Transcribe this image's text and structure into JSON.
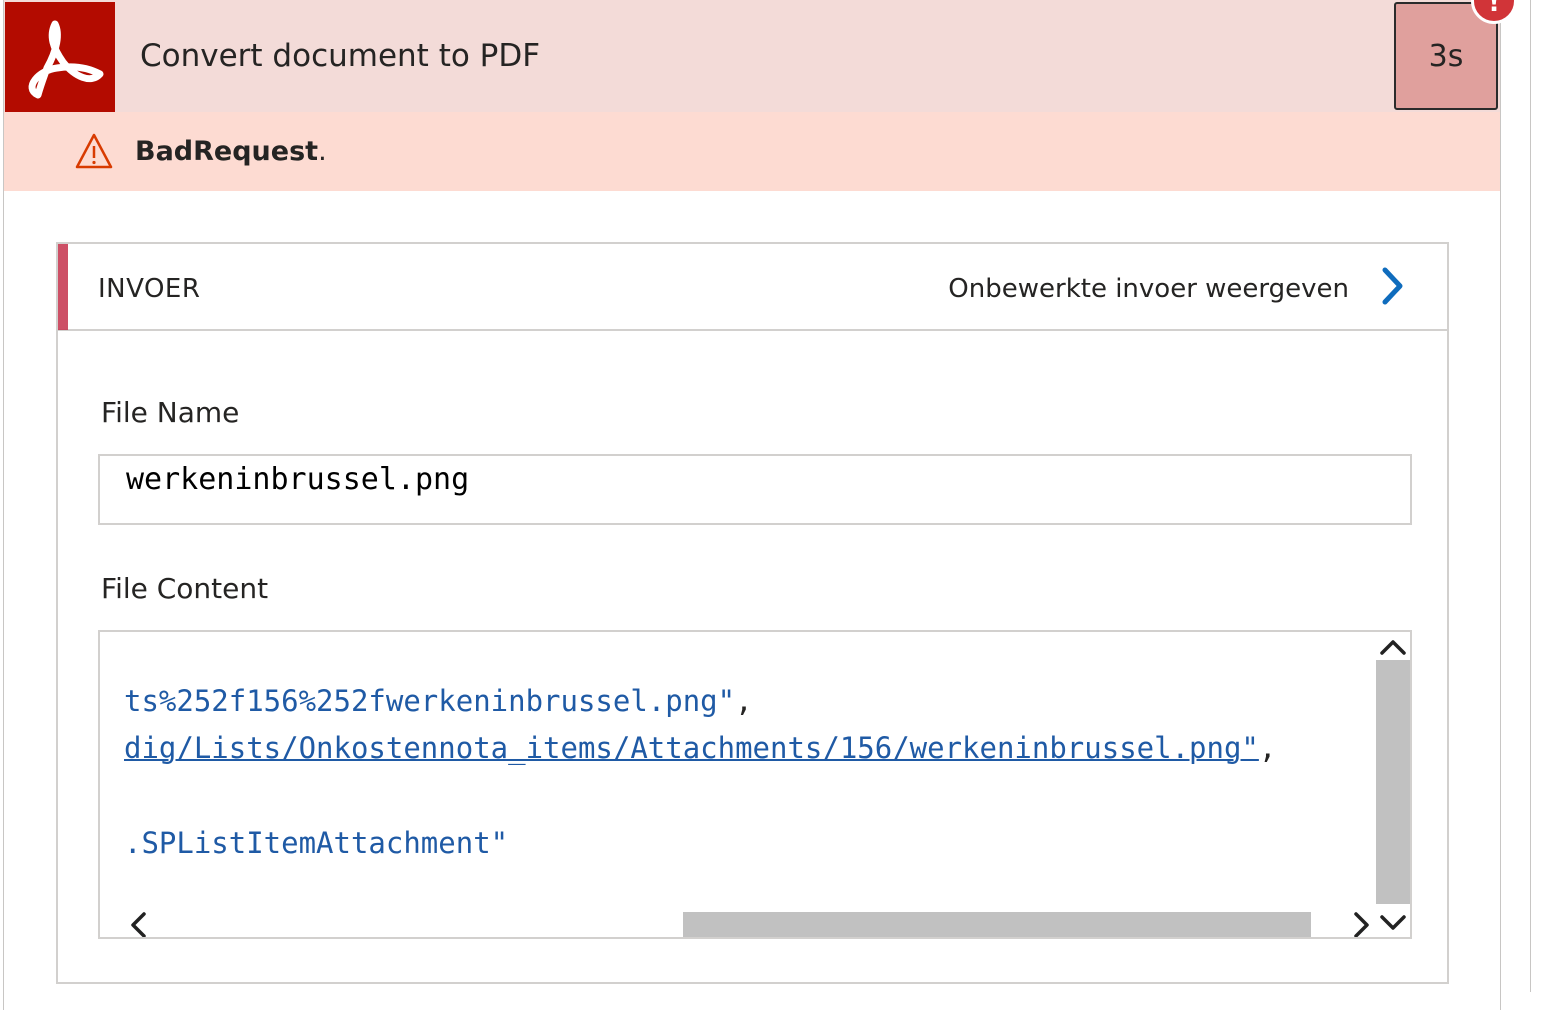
{
  "header": {
    "title": "Convert document to PDF",
    "duration": "3s",
    "error_badge": "!",
    "logo_icon": "adobe-acrobat-icon",
    "logo_color": "#b30b00",
    "background_color": "#f3dbd8"
  },
  "error": {
    "code": "BadRequest",
    "suffix": ".",
    "icon": "warning-icon",
    "color": "#d83b01"
  },
  "inputs": {
    "section_title": "INVOER",
    "raw_link": "Onbewerkte invoer weergeven",
    "link_color": "#0f6cbd",
    "fields": [
      {
        "label": "File Name",
        "value": "werkeninbrussel.png"
      },
      {
        "label": "File Content",
        "lines": [
          {
            "text": "ts%252f156%252fwerkeninbrussel.png\"",
            "trail": ","
          },
          {
            "text": "dig/Lists/Onkostennota_items/Attachments/156/werkeninbrussel.png\"",
            "trail": ","
          },
          {
            "text": ".SPListItemAttachment\"",
            "trail": ""
          }
        ]
      }
    ]
  }
}
